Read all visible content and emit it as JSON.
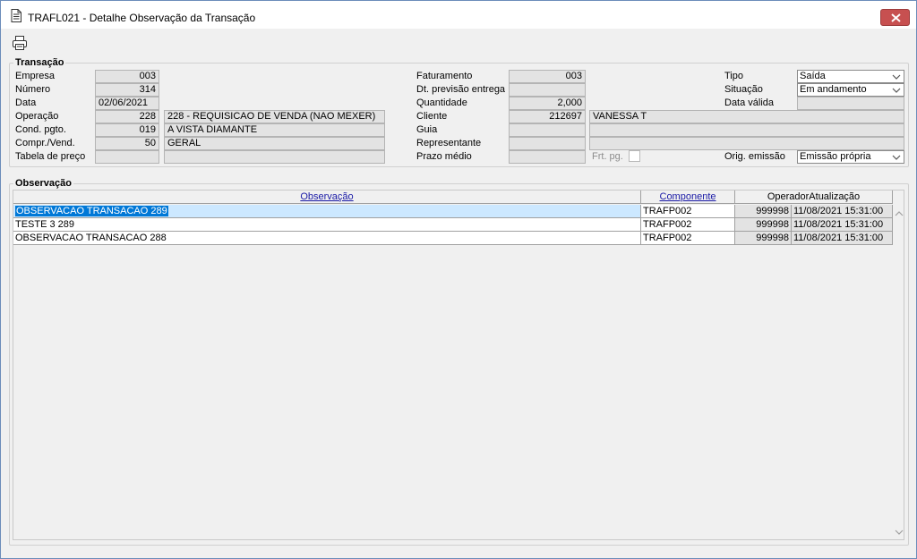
{
  "window": {
    "title": "TRAFL021 - Detalhe Observação da Transação"
  },
  "toolbar": {
    "print_icon": "printer-icon"
  },
  "transacao": {
    "title": "Transação",
    "empresa": {
      "label": "Empresa",
      "value": "003"
    },
    "numero": {
      "label": "Número",
      "value": "314"
    },
    "data": {
      "label": "Data",
      "value": "02/06/2021"
    },
    "operacao": {
      "label": "Operação",
      "code": "228",
      "desc": "228 - REQUISICAO DE VENDA (NAO MEXER)"
    },
    "cond_pgto": {
      "label": "Cond. pgto.",
      "code": "019",
      "desc": "A VISTA DIAMANTE"
    },
    "compr_vend": {
      "label": "Compr./Vend.",
      "code": "50",
      "desc": "GERAL"
    },
    "tabela_preco": {
      "label": "Tabela de preço",
      "code": "",
      "desc": ""
    },
    "faturamento": {
      "label": "Faturamento",
      "value": "003"
    },
    "dt_previsao": {
      "label": "Dt. previsão entrega",
      "value": ""
    },
    "quantidade": {
      "label": "Quantidade",
      "value": "2,000"
    },
    "cliente": {
      "label": "Cliente",
      "code": "212697",
      "name": "VANESSA T"
    },
    "guia": {
      "label": "Guia",
      "code": "",
      "name": ""
    },
    "representante": {
      "label": "Representante",
      "code": "",
      "name": ""
    },
    "prazo_medio": {
      "label": "Prazo médio",
      "value": ""
    },
    "frt_pg": {
      "label": "Frt. pg."
    },
    "tipo": {
      "label": "Tipo",
      "value": "Saída"
    },
    "situacao": {
      "label": "Situação",
      "value": "Em andamento"
    },
    "data_valida": {
      "label": "Data válida",
      "value": ""
    },
    "orig_emissao": {
      "label": "Orig. emissão",
      "value": "Emissão própria"
    }
  },
  "observacao": {
    "title": "Observação",
    "columns": {
      "observacao": "Observação",
      "componente": "Componente",
      "operador": "Operador",
      "atualizacao": "Atualização"
    },
    "rows": [
      {
        "observacao": "OBSERVACAO TRANSACAO 289",
        "componente": "TRAFP002",
        "operador": "999998",
        "atualizacao": "11/08/2021 15:31:00"
      },
      {
        "observacao": "TESTE 3 289",
        "componente": "TRAFP002",
        "operador": "999998",
        "atualizacao": "11/08/2021 15:31:00"
      },
      {
        "observacao": "OBSERVACAO TRANSACAO 288",
        "componente": "TRAFP002",
        "operador": "999998",
        "atualizacao": "11/08/2021 15:31:00"
      }
    ]
  }
}
